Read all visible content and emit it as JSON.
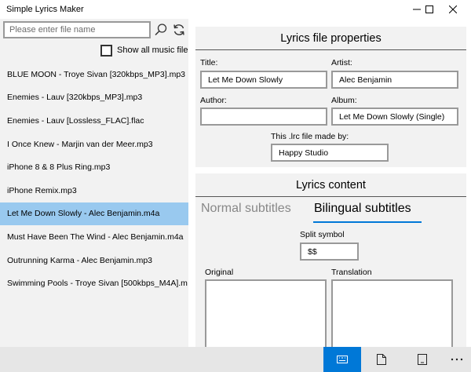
{
  "window": {
    "title": "Simple Lyrics Maker"
  },
  "sidebar": {
    "search_placeholder": "Please enter file name",
    "show_all_label": "Show all music file",
    "files": [
      "BLUE MOON - Troye Sivan [320kbps_MP3].mp3",
      "Enemies - Lauv [320kbps_MP3].mp3",
      "Enemies - Lauv [Lossless_FLAC].flac",
      "I Once Knew - Marjin van der Meer.mp3",
      "iPhone 8 & 8 Plus Ring.mp3",
      "iPhone Remix.mp3",
      "Let Me Down Slowly - Alec Benjamin.m4a",
      "Must Have Been The Wind - Alec Benjamin.m4a",
      "Outrunning Karma - Alec Benjamin.mp3",
      "Swimming Pools - Troye Sivan [500kbps_M4A].m"
    ],
    "selected_index": 6
  },
  "properties": {
    "header": "Lyrics file properties",
    "title_label": "Title:",
    "title_value": "Let Me Down Slowly",
    "artist_label": "Artist:",
    "artist_value": "Alec Benjamin",
    "author_label": "Author:",
    "author_value": "",
    "album_label": "Album:",
    "album_value": "Let Me Down Slowly (Single)",
    "madeby_label": "This .lrc file made by:",
    "madeby_value": "Happy Studio"
  },
  "content": {
    "header": "Lyrics content",
    "tab_normal": "Normal subtitles",
    "tab_bilingual": "Bilingual subtitles",
    "active_tab": "bilingual",
    "split_label": "Split symbol",
    "split_value": "$$",
    "original_label": "Original",
    "translation_label": "Translation"
  },
  "colors": {
    "selection": "#99c9ef",
    "accent": "#0078d7",
    "panel": "#f2f2f2"
  },
  "icons": [
    "search-icon",
    "refresh-icon",
    "minimize-icon",
    "maximize-icon",
    "close-icon",
    "keyboard-icon",
    "new-file-icon",
    "device-icon",
    "more-icon"
  ]
}
